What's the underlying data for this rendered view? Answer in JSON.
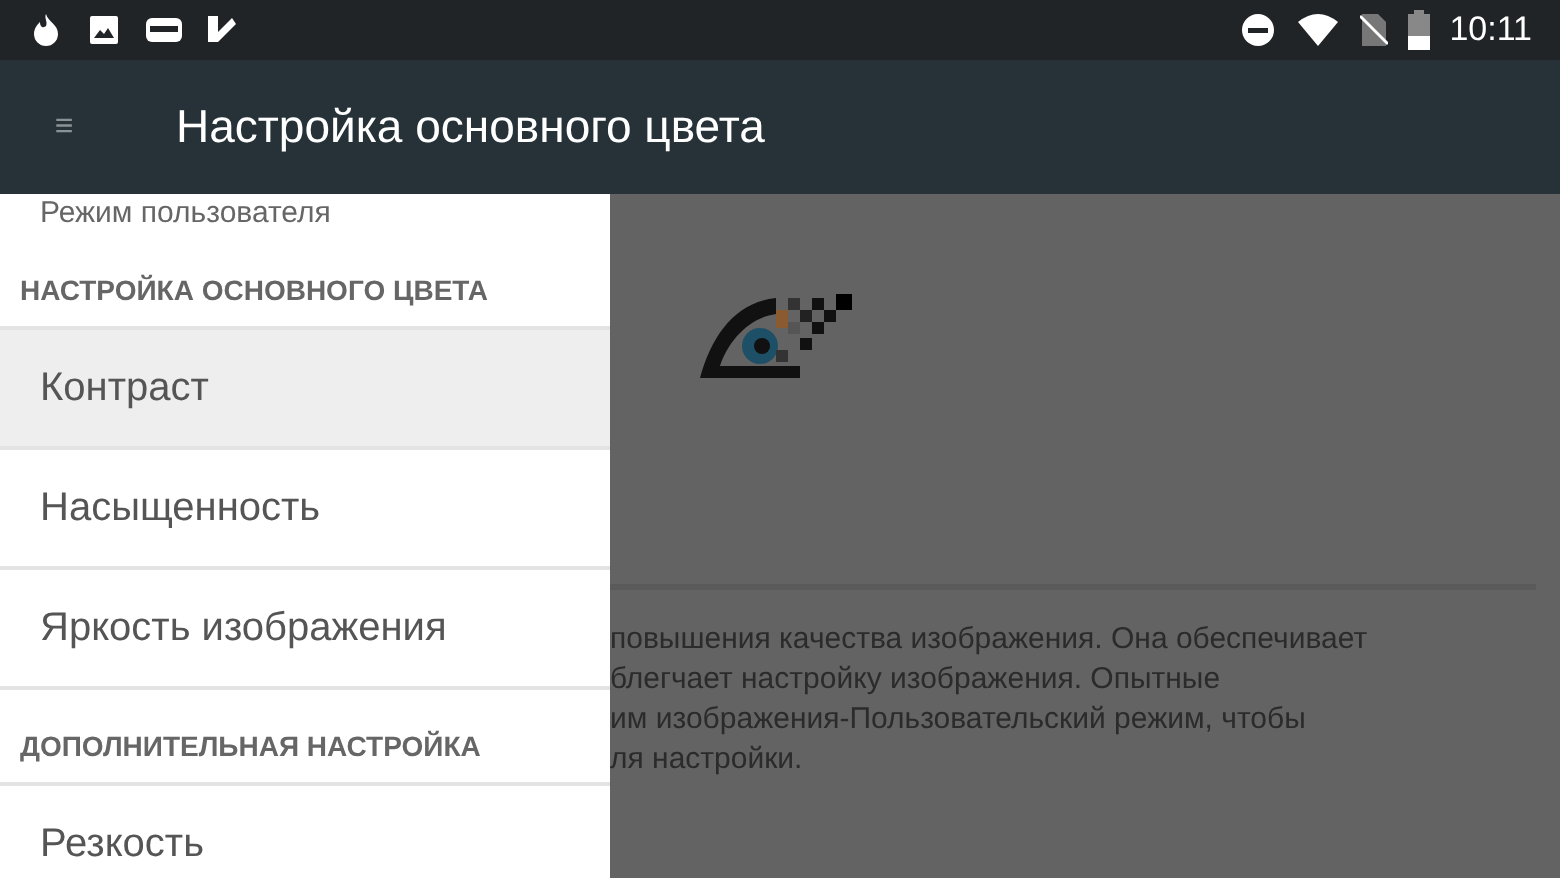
{
  "status_bar": {
    "time": "10:11"
  },
  "app_bar": {
    "menu_glyph": "≡",
    "title": "Настройка основного цвета"
  },
  "drawer": {
    "items": [
      {
        "kind": "caption",
        "label": "Режим пользователя"
      },
      {
        "kind": "header",
        "label": "НАСТРОЙКА ОСНОВНОГО ЦВЕТА"
      },
      {
        "kind": "item",
        "label": "Контраст",
        "selected": true
      },
      {
        "kind": "item",
        "label": "Насыщенность",
        "selected": false
      },
      {
        "kind": "item",
        "label": "Яркость изображения",
        "selected": false
      },
      {
        "kind": "header",
        "label": "ДОПОЛНИТЕЛЬНАЯ НАСТРОЙКА"
      },
      {
        "kind": "item",
        "label": "Резкость",
        "selected": false
      }
    ]
  },
  "content": {
    "description_lines": [
      "повышения качества изображения. Она обеспечивает",
      "блегчает настройку изображения. Опытные",
      "им изображения-Пользовательский режим, чтобы",
      "ля настройки."
    ]
  }
}
